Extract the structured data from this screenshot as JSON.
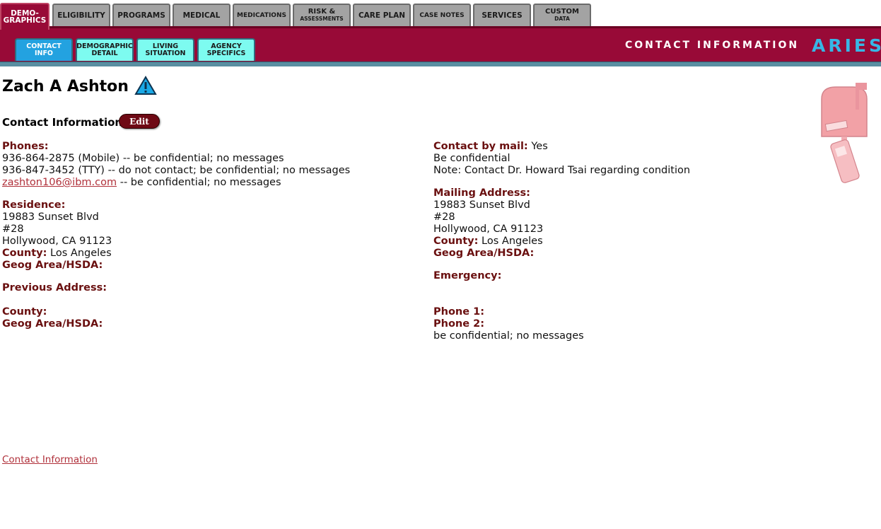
{
  "top_tabs": [
    {
      "label": "DEMO-\nGRAPHICS",
      "active": true
    },
    {
      "label": "ELIGIBILITY"
    },
    {
      "label": "PROGRAMS"
    },
    {
      "label": "MEDICAL"
    },
    {
      "label": "MEDICATIONS"
    },
    {
      "label_line1": "RISK &",
      "label_line2": "ASSESSMENTS"
    },
    {
      "label": "CARE PLAN"
    },
    {
      "label": "CASE NOTES"
    },
    {
      "label": "SERVICES"
    },
    {
      "label_line1": "CUSTOM",
      "label_line2": "DATA"
    }
  ],
  "sub_tabs": [
    {
      "label": "CONTACT\nINFO",
      "active": true
    },
    {
      "label": "DEMOGRAPHIC\nDETAIL"
    },
    {
      "label": "LIVING\nSITUATION"
    },
    {
      "label": "AGENCY\nSPECIFICS"
    }
  ],
  "header": {
    "section_title": "CONTACT INFORMATION",
    "logo": "ARIES",
    "colors": {
      "band": "#980a37",
      "accent": "#37b7e5",
      "subtab": "#7dfbf0",
      "subtab_active": "#23a2e0"
    }
  },
  "client": {
    "name": "Zach A Ashton",
    "alert_icon": "warning-triangle-icon"
  },
  "contact": {
    "heading": "Contact Information",
    "edit_label": "Edit",
    "phones_label": "Phones:",
    "phone1": "936-864-2875 (Mobile) -- be confidential; no messages",
    "phone2": "936-847-3452 (TTY) -- do not contact; be confidential; no messages",
    "email": "zashton106@ibm.com",
    "email_note": " -- be confidential; no messages",
    "residence_label": "Residence:",
    "res_line1": "19883 Sunset Blvd",
    "res_line2": "#28",
    "res_line3": "Hollywood, CA 91123",
    "county_label": "County:",
    "res_county": " Los Angeles",
    "geog_label": "Geog Area/HSDA:",
    "prev_label": "Previous Address:",
    "prev_county_label": "County:",
    "prev_geog_label": "Geog Area/HSDA:",
    "mail_label": "Contact by mail:",
    "mail_value": " Yes",
    "mail_note1": "Be confidential",
    "mail_note2": "Note: Contact Dr. Howard Tsai regarding condition",
    "mailing_label": "Mailing Address:",
    "mail_line1": "19883 Sunset Blvd",
    "mail_line2": "#28",
    "mail_line3": "Hollywood, CA 91123",
    "mail_county_label": "County:",
    "mail_county": " Los Angeles",
    "mail_geog_label": "Geog Area/HSDA:",
    "emergency_label": "Emergency:",
    "ephone1_label": "Phone 1:",
    "ephone2_label": "Phone 2:",
    "ephone2_note": "be confidential; no messages"
  },
  "footer": {
    "link": "Contact Information"
  }
}
